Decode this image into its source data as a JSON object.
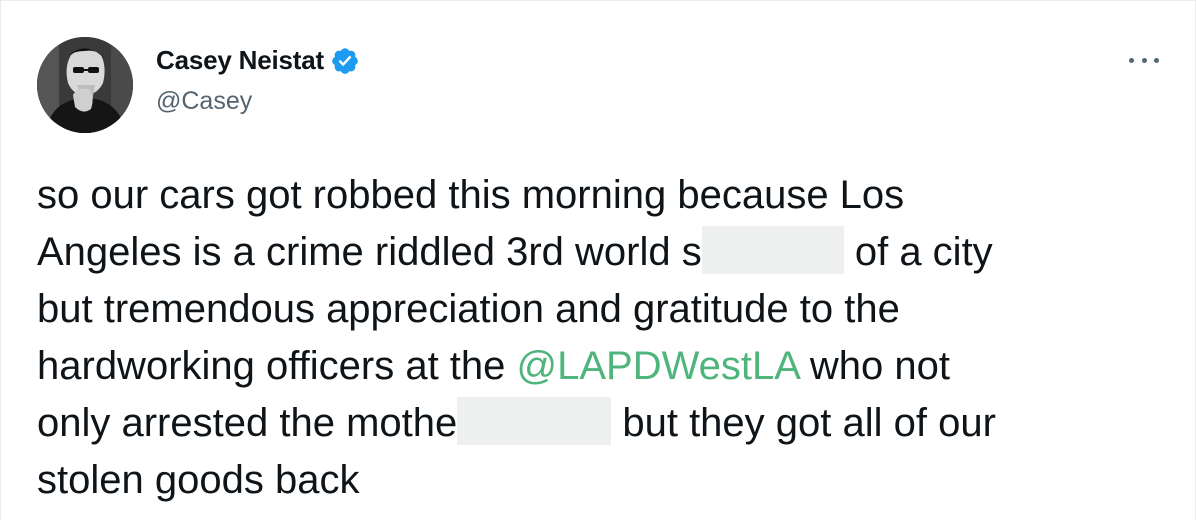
{
  "author": {
    "display_name": "Casey Neistat",
    "handle": "@Casey",
    "verified": true,
    "avatar_icon": "profile-photo-avatar",
    "verified_icon": "verified-badge-icon",
    "verified_color": "#1d9bf0"
  },
  "menu": {
    "icon": "more-options-icon"
  },
  "tweet": {
    "line1": "so our cars got robbed this morning because Los",
    "line2_start": "Angeles is a crime riddled 3rd world s",
    "line2_end": " of a city",
    "line3": "but tremendous appreciation and gratitude to the",
    "line4_start": "hardworking officers at the ",
    "mention": "@LAPDWestLA",
    "line4_end": " who not",
    "line5_start": "only arrested the mothe",
    "line5_end": " but they got all of our",
    "line6": "stolen goods back"
  },
  "colors": {
    "text": "#0f1419",
    "secondary": "#536471",
    "mention": "#4fb57c",
    "redaction": "#eef0f0"
  }
}
